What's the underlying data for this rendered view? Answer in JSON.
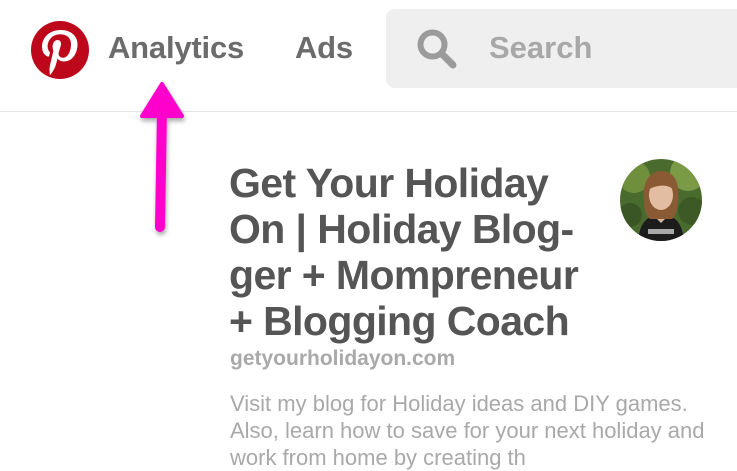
{
  "header": {
    "logo_icon": "pinterest-logo-icon",
    "nav": {
      "analytics_label": "Analytics",
      "ads_label": "Ads"
    },
    "search": {
      "icon": "search-icon",
      "placeholder": "Search"
    }
  },
  "annotation": {
    "icon": "arrow-up-icon",
    "color": "#ff00cc"
  },
  "profile": {
    "title": "Get Your Holiday On | Holiday Blog-ger + Mompreneur + Blogging Coach",
    "website": "getyourholidayon.com",
    "bio": "Visit my blog for Holiday ideas and DIY games. Also, learn how to save for your next holiday and work from home by creating th",
    "avatar": "avatar-photo"
  },
  "colors": {
    "brand_red": "#bd081c",
    "nav_text": "#6b6b6b",
    "title_text": "#555555",
    "muted_text": "#a9a9a9",
    "search_bg": "#efefef"
  }
}
